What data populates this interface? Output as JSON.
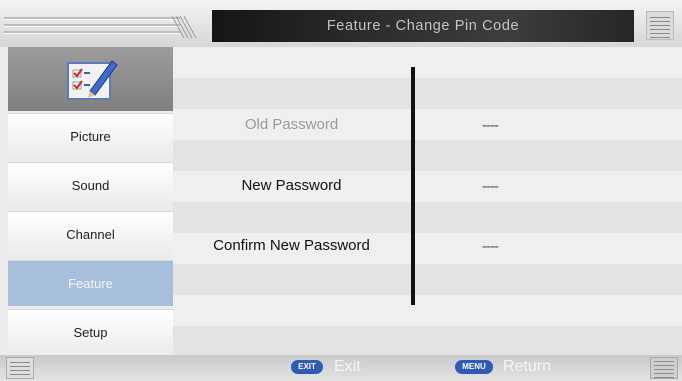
{
  "header": {
    "title": "Feature - Change Pin Code"
  },
  "sidebar": {
    "icon": "checklist-edit-icon",
    "items": [
      {
        "label": "Picture"
      },
      {
        "label": "Sound"
      },
      {
        "label": "Channel"
      },
      {
        "label": "Feature",
        "active": true
      },
      {
        "label": "Setup"
      }
    ]
  },
  "content": {
    "rows": [
      {
        "label": "Old Password",
        "value": "----",
        "disabled": true
      },
      {
        "label": "New Password",
        "value": "----"
      },
      {
        "label": "Confirm New Password",
        "value": "----"
      }
    ]
  },
  "footer": {
    "exit_key": "EXIT",
    "exit_label": "Exit",
    "menu_key": "MENU",
    "return_label": "Return"
  },
  "colors": {
    "active_item": "#a8bfdc",
    "key_badge": "#2f5bb8",
    "title_bar": "#1e1e1e"
  }
}
